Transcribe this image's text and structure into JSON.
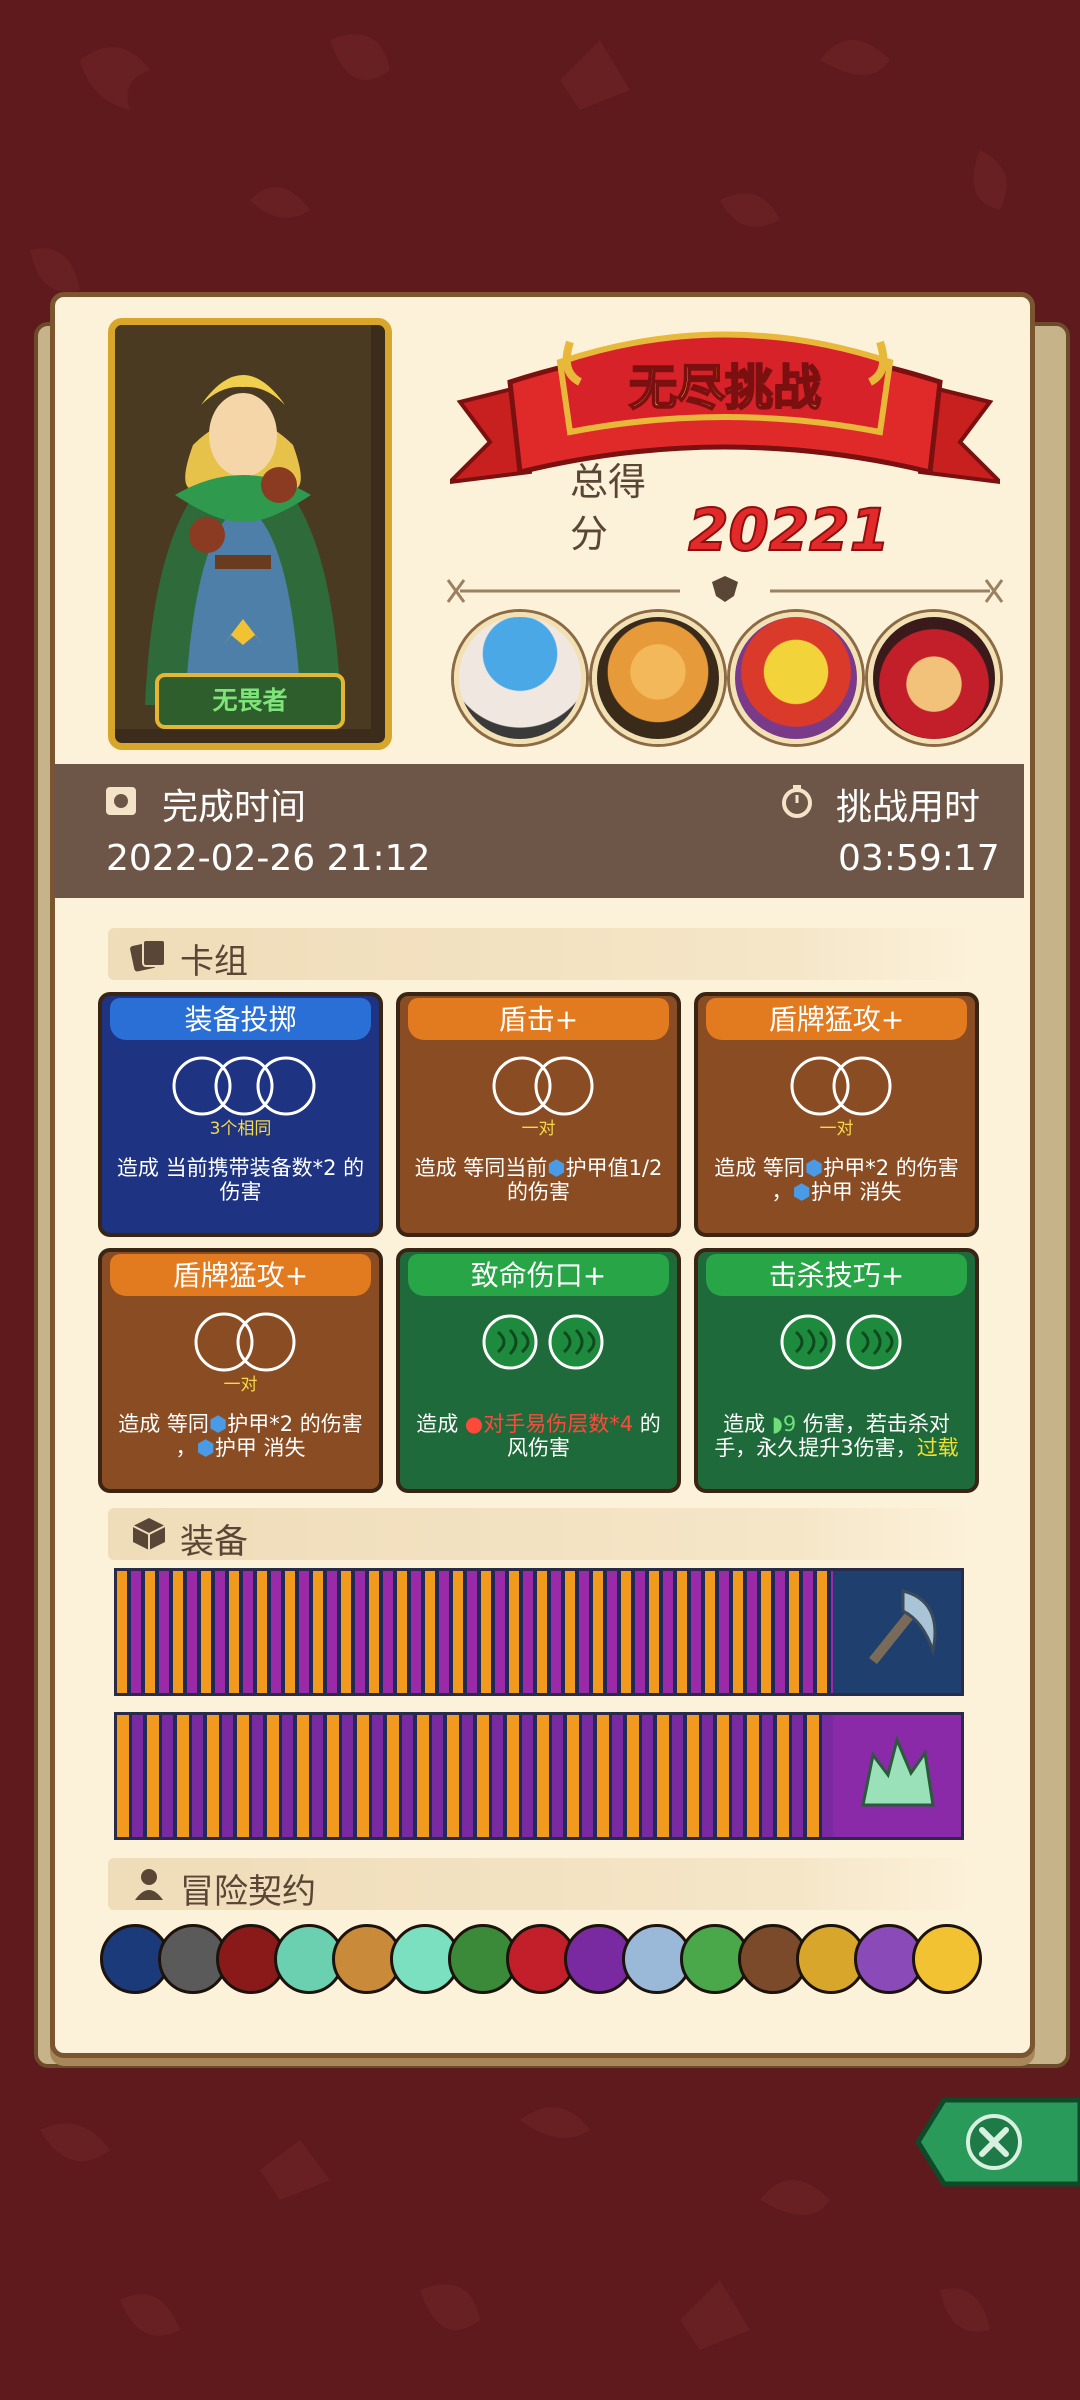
{
  "hero": {
    "name": "无畏者"
  },
  "header": {
    "banner_title": "无尽挑战",
    "score_label": "总得分",
    "score_value": "20221"
  },
  "bosses": [
    {
      "icon": "mushroom-sage-boss-icon"
    },
    {
      "icon": "ogre-king-boss-icon"
    },
    {
      "icon": "yellow-demon-boss-icon"
    },
    {
      "icon": "red-hat-demon-boss-icon"
    }
  ],
  "info": {
    "finish_label": "完成时间",
    "finish_value": "2022-02-26 21:12",
    "time_label": "挑战用时",
    "time_value": "03:59:17"
  },
  "sections": {
    "deck": "卡组",
    "equipment": "装备",
    "contract": "冒险契约"
  },
  "cards": [
    {
      "title": "装备投掷",
      "sub": "3个相同",
      "desc_a": "造成 当前携带装备数*2 的",
      "desc_b": "伤害",
      "color": "#1e3382"
    },
    {
      "title": "盾击+",
      "sub": "一对",
      "desc_a": "造成 等同当前",
      "desc_a2": "护甲值1/2",
      "desc_b": "的伤害",
      "color": "#8a4c22"
    },
    {
      "title": "盾牌猛攻+",
      "sub": "一对",
      "desc_a": "造成 等同",
      "desc_a2": "护甲*2 的伤害",
      "desc_b1": "，",
      "desc_b2": "护甲 消失",
      "color": "#8a4c22"
    },
    {
      "title": "盾牌猛攻+",
      "sub": "一对",
      "desc_a": "造成 等同",
      "desc_a2": "护甲*2 的伤害",
      "desc_b1": "，",
      "desc_b2": "护甲 消失",
      "color": "#8a4c22"
    },
    {
      "title": "致命伤口+",
      "desc_a": "造成",
      "desc_hl": "对手易伤层数*4",
      "desc_a3": "的",
      "desc_b": "风伤害",
      "color": "#1e6a3a"
    },
    {
      "title": "击杀技巧+",
      "desc_a": "造成",
      "desc_num": "9",
      "desc_a3": "伤害，若击杀对",
      "desc_b": "手，永久提升3伤害，",
      "desc_hl": "过载",
      "color": "#1e6a3a"
    }
  ],
  "equipment": [
    {
      "icon": "scythe-axe-icon",
      "bg": "#1f3f6e"
    },
    {
      "icon": "green-crystal-icon",
      "bg": "#8a2aa8"
    }
  ],
  "contracts": [
    "blue-flame-skull-icon",
    "mechanical-gear-icon",
    "red-rune-icon",
    "potion-icon",
    "mushroom-icon",
    "jar-icon",
    "green-dragon-icon",
    "red-glove-icon",
    "purple-eye-icon",
    "dice-icon",
    "green-bottle-icon",
    "pipe-icon",
    "gold-bar-icon",
    "purple-crab-icon",
    "gold-coin-icon"
  ],
  "colors": {
    "background": "#5e1a1c",
    "panel": "#fcf1d9",
    "score": "#e22a2a",
    "info_bar": "#6d5648"
  },
  "buttons": {
    "close": "close-icon"
  }
}
